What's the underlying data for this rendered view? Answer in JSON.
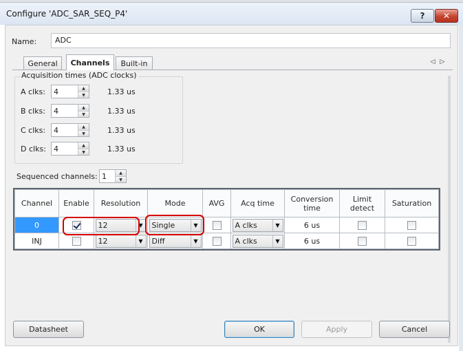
{
  "window": {
    "title": "Configure 'ADC_SAR_SEQ_P4'",
    "help_label": "?",
    "close_label": "✕"
  },
  "name_field": {
    "label": "Name:",
    "value": "ADC"
  },
  "tabs": [
    {
      "label": "General",
      "active": false
    },
    {
      "label": "Channels",
      "active": true
    },
    {
      "label": "Built-in",
      "active": false
    }
  ],
  "tab_arrows": {
    "left": "◁",
    "right": "▷"
  },
  "acquisition": {
    "legend": "Acquisition times (ADC clocks)",
    "rows": [
      {
        "label": "A clks:",
        "value": "4",
        "time": "1.33 us"
      },
      {
        "label": "B clks:",
        "value": "4",
        "time": "1.33 us"
      },
      {
        "label": "C clks:",
        "value": "4",
        "time": "1.33 us"
      },
      {
        "label": "D clks:",
        "value": "4",
        "time": "1.33 us"
      }
    ]
  },
  "sequenced": {
    "label": "Sequenced channels:",
    "value": "1"
  },
  "spin_arrows": {
    "up": "▲",
    "down": "▼"
  },
  "combo_arrow": "▼",
  "table": {
    "headers": [
      "Channel",
      "Enable",
      "Resolution",
      "Mode",
      "AVG",
      "Acq time",
      "Conversion time",
      "Limit detect",
      "Saturation"
    ],
    "rows": [
      {
        "channel": "0",
        "enable": true,
        "resolution": "12",
        "mode": "Single",
        "avg": false,
        "acq_time": "A clks",
        "conversion": "6 us",
        "limit": false,
        "saturation": false,
        "selected": true
      },
      {
        "channel": "INJ",
        "enable": false,
        "resolution": "12",
        "mode": "Diff",
        "avg": false,
        "acq_time": "A clks",
        "conversion": "6 us",
        "limit": false,
        "saturation": false,
        "selected": false
      }
    ]
  },
  "buttons": {
    "datasheet": "Datasheet",
    "ok": "OK",
    "apply": "Apply",
    "cancel": "Cancel"
  },
  "colors": {
    "selected_row": "#3399ff",
    "highlight": "#d40000"
  }
}
